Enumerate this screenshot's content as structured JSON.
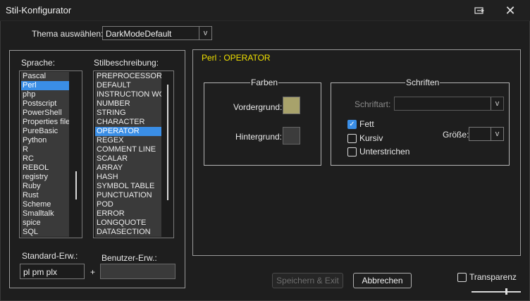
{
  "window": {
    "title": "Stil-Konfigurator"
  },
  "theme": {
    "label": "Thema auswählen:",
    "value": "DarkModeDefault"
  },
  "language": {
    "label": "Sprache:",
    "items": [
      "Pascal",
      "Perl",
      "php",
      "Postscript",
      "PowerShell",
      "Properties file",
      "PureBasic",
      "Python",
      "R",
      "RC",
      "REBOL",
      "registry",
      "Ruby",
      "Rust",
      "Scheme",
      "Smalltalk",
      "spice",
      "SQL"
    ],
    "selected": "Perl"
  },
  "styles": {
    "label": "Stilbeschreibung:",
    "items": [
      "PREPROCESSOR",
      "DEFAULT",
      "INSTRUCTION WO",
      "NUMBER",
      "STRING",
      "CHARACTER",
      "OPERATOR",
      "REGEX",
      "COMMENT LINE",
      "SCALAR",
      "ARRAY",
      "HASH",
      "SYMBOL TABLE",
      "PUNCTUATION",
      "POD",
      "ERROR",
      "LONGQUOTE",
      "DATASECTION"
    ],
    "selected": "OPERATOR"
  },
  "extensions": {
    "standard_label": "Standard-Erw.:",
    "standard_value": "pl pm plx",
    "plus": "+",
    "user_label": "Benutzer-Erw.:",
    "user_value": ""
  },
  "detail": {
    "heading": "Perl : OPERATOR",
    "heading_color": "#f0e000",
    "colors_group": "Farben",
    "foreground_label": "Vordergrund:",
    "foreground_color": "#a8a26b",
    "background_label": "Hintergrund:",
    "background_color": "#3c3c3c",
    "fonts_group": "Schriften",
    "font_label": "Schriftart:",
    "font_value": "",
    "bold_label": "Fett",
    "bold_checked": true,
    "italic_label": "Kursiv",
    "italic_checked": false,
    "underline_label": "Unterstrichen",
    "underline_checked": false,
    "size_label": "Größe:",
    "size_value": ""
  },
  "footer": {
    "save_label": "Speichern & Exit",
    "cancel_label": "Abbrechen",
    "transparency_label": "Transparenz",
    "transparency_checked": false,
    "transparency_level": 0.7
  },
  "icons": {
    "restore": "restore-window-icon",
    "close": "close-icon",
    "dropdown": "chevron-down-icon",
    "check": "checkmark-icon"
  }
}
